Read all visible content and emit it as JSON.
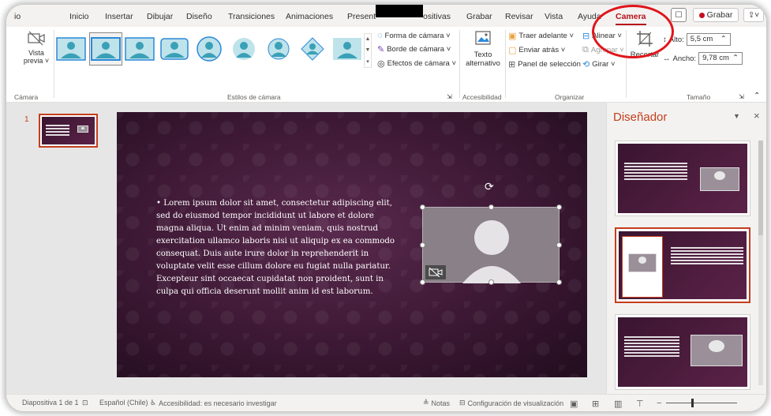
{
  "menu": {
    "tabs": [
      {
        "label": "io"
      },
      {
        "label": "Inicio"
      },
      {
        "label": "Insertar"
      },
      {
        "label": "Dibujar"
      },
      {
        "label": "Diseño"
      },
      {
        "label": "Transiciones"
      },
      {
        "label": "Animaciones"
      },
      {
        "label": "Present"
      },
      {
        "label": "ositivas"
      },
      {
        "label": "Grabar"
      },
      {
        "label": "Revisar"
      },
      {
        "label": "Vista"
      },
      {
        "label": "Ayuda"
      },
      {
        "label": "Camera"
      }
    ],
    "grabar_label": "Grabar"
  },
  "ribbon": {
    "camara_group": {
      "vista_line1": "Vista",
      "vista_line2": "previa ˅",
      "label": "Cámara"
    },
    "estilos_group": {
      "label": "Estilos de cámara"
    },
    "shape_cmds": {
      "forma": "Forma de cámara ˅",
      "borde": "Borde de cámara ˅",
      "efectos": "Efectos de cámara ˅"
    },
    "accesibilidad_group": {
      "line1": "Texto",
      "line2": "alternativo",
      "label": "Accesibilidad"
    },
    "organizar_group": {
      "traer": "Traer adelante ˅",
      "enviar": "Enviar atrás ˅",
      "panel": "Panel de selección",
      "alinear": "Alinear ˅",
      "agrupar": "Agrupar ˅",
      "girar": "Girar ˅",
      "label": "Organizar"
    },
    "tamano_group": {
      "recortar": "Recortar",
      "alto_label": "Alto:",
      "alto_value": "5,5 cm",
      "ancho_label": "Ancho:",
      "ancho_value": "9,78 cm",
      "label": "Tamaño"
    }
  },
  "slides_panel": {
    "slide_number": "1"
  },
  "slide": {
    "body_text": "• Lorem ipsum dolor sit amet, consectetur adipiscing elit, sed do eiusmod tempor incididunt ut labore et dolore magna aliqua. Ut enim ad minim veniam, quis nostrud exercitation ullamco laboris nisi ut aliquip ex ea commodo consequat. Duis aute irure dolor in reprehenderit in voluptate velit esse cillum dolore eu fugiat nulla pariatur. Excepteur sint occaecat cupidatat non proident, sunt in culpa qui officia deserunt mollit anim id est laborum."
  },
  "designer": {
    "title": "Diseñador"
  },
  "statusbar": {
    "slide_info": "Diapositiva 1 de 1",
    "language": "Español (Chile)",
    "accessibility": "Accesibilidad: es necesario investigar",
    "notes": "Notas",
    "view_settings": "Configuración de visualización"
  },
  "colors": {
    "accent": "#c43e1c",
    "camera_tab": "#b4121b",
    "annotation_circle": "#e0151b"
  }
}
